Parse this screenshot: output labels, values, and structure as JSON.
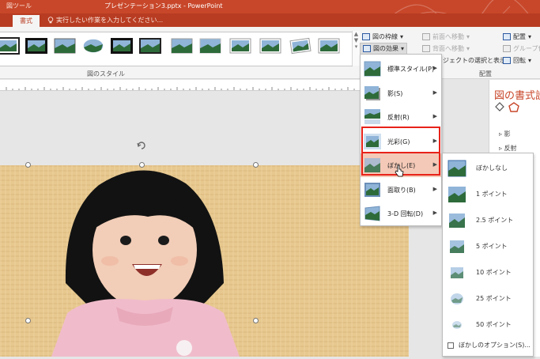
{
  "title_bar": {
    "context_tab": "図ツール",
    "document_title": "プレゼンテーション3.pptx - PowerPoint"
  },
  "tab_bar": {
    "active_tab": "書式",
    "tell_me_placeholder": "実行したい作業を入力してください..."
  },
  "ribbon": {
    "picture_styles_group": "図のスタイル",
    "picture_border": "図の枠線",
    "picture_effects": "図の効果",
    "bring_forward": "前面へ移動",
    "send_backward": "背面へ移動",
    "selection_pane": "ジェクトの選択と表示",
    "align": "配置",
    "group": "グループ化",
    "rotate": "回転",
    "arrange_group": "配置"
  },
  "effects_menu": {
    "items": [
      {
        "label": "標準スタイル(P)"
      },
      {
        "label": "影(S)"
      },
      {
        "label": "反射(R)"
      },
      {
        "label": "光彩(G)"
      },
      {
        "label": "ぼかし(E)"
      },
      {
        "label": "面取り(B)"
      },
      {
        "label": "3-D 回転(D)"
      }
    ]
  },
  "soft_edges_submenu": {
    "items": [
      {
        "label": "ぼかしなし"
      },
      {
        "label": "1 ポイント"
      },
      {
        "label": "2.5 ポイント"
      },
      {
        "label": "5 ポイント"
      },
      {
        "label": "10 ポイント"
      },
      {
        "label": "25 ポイント"
      },
      {
        "label": "50 ポイント"
      }
    ],
    "options": "ぼかしのオプション(S)..."
  },
  "format_pane": {
    "title": "図の書式設",
    "items": [
      {
        "label": "影"
      },
      {
        "label": "反射"
      }
    ]
  },
  "colors": {
    "title_bar": "#c8472a",
    "highlight_box": "#e8231a",
    "hover": "#f4c9b7"
  }
}
